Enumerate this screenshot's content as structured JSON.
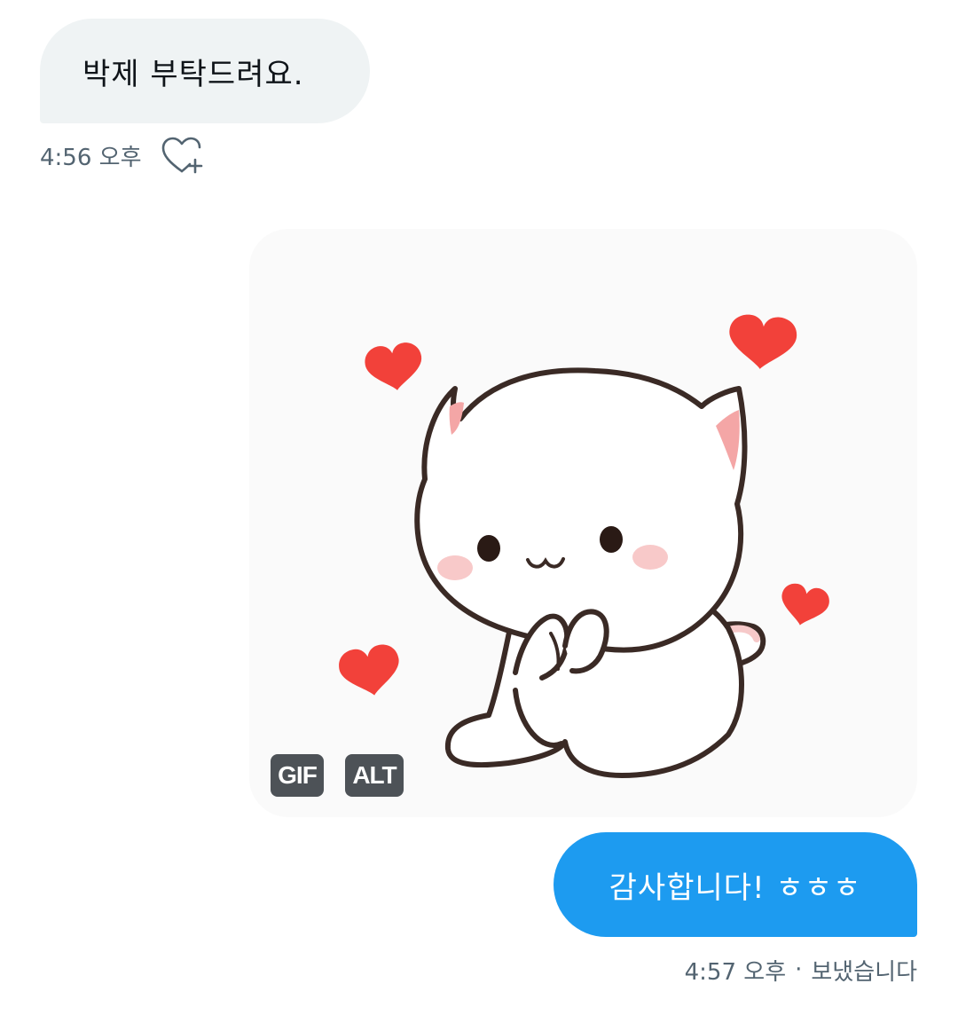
{
  "messages": {
    "incoming": {
      "text": "박제 부탁드려요.",
      "time": "4:56 오후",
      "react_icon": "heart-plus-icon"
    },
    "gif": {
      "badge_gif": "GIF",
      "badge_alt": "ALT"
    },
    "outgoing": {
      "text": "감사합니다! ㅎㅎㅎ",
      "time": "4:57 오후",
      "separator": "·",
      "status": "보냈습니다"
    }
  },
  "colors": {
    "incoming_bubble": "#eff3f4",
    "outgoing_bubble": "#1d9bf0",
    "meta_text": "#536471",
    "heart_red": "#f2413a"
  }
}
